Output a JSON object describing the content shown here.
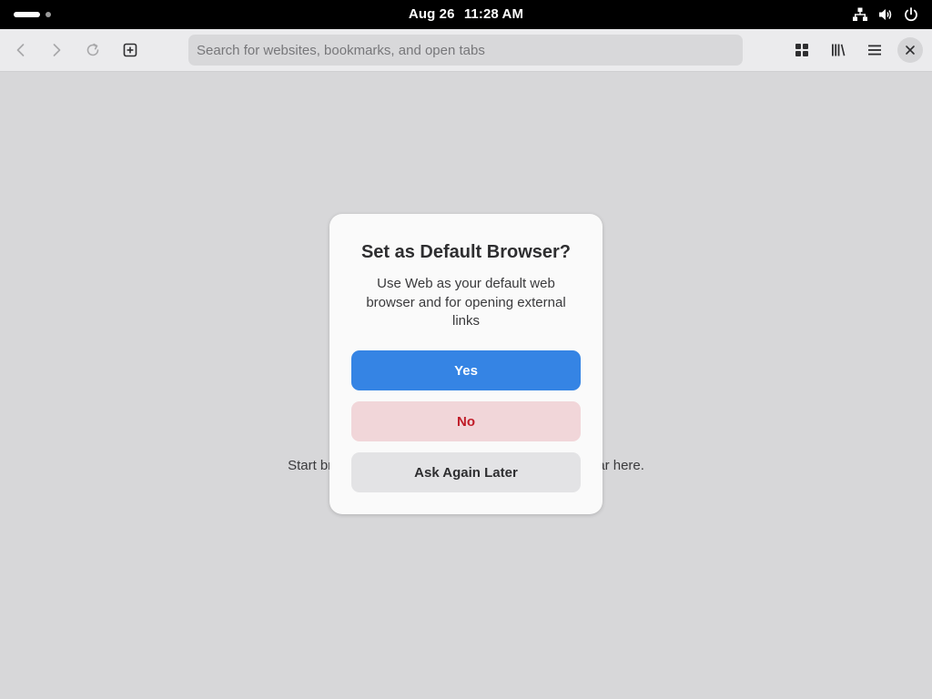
{
  "topbar": {
    "date": "Aug 26",
    "time": "11:28 AM",
    "icons": [
      "workspace-indicator",
      "network-icon",
      "volume-icon",
      "power-icon"
    ]
  },
  "toolbar": {
    "search_placeholder": "Search for websites, bookmarks, and open tabs",
    "search_value": "",
    "icons": [
      "back-icon",
      "forward-icon",
      "reload-icon",
      "new-tab-icon",
      "tab-overview-icon",
      "library-icon",
      "menu-icon",
      "close-icon"
    ]
  },
  "content": {
    "empty_message": "Start browsing and your most-visited sites will appear here."
  },
  "dialog": {
    "title": "Set as Default Browser?",
    "body": "Use Web as your default web browser and for opening external links",
    "yes_label": "Yes",
    "no_label": "No",
    "later_label": "Ask Again Later"
  },
  "colors": {
    "accent": "#3584e4",
    "destructive_text": "#c01c28",
    "destructive_bg": "#f1d6d9"
  }
}
